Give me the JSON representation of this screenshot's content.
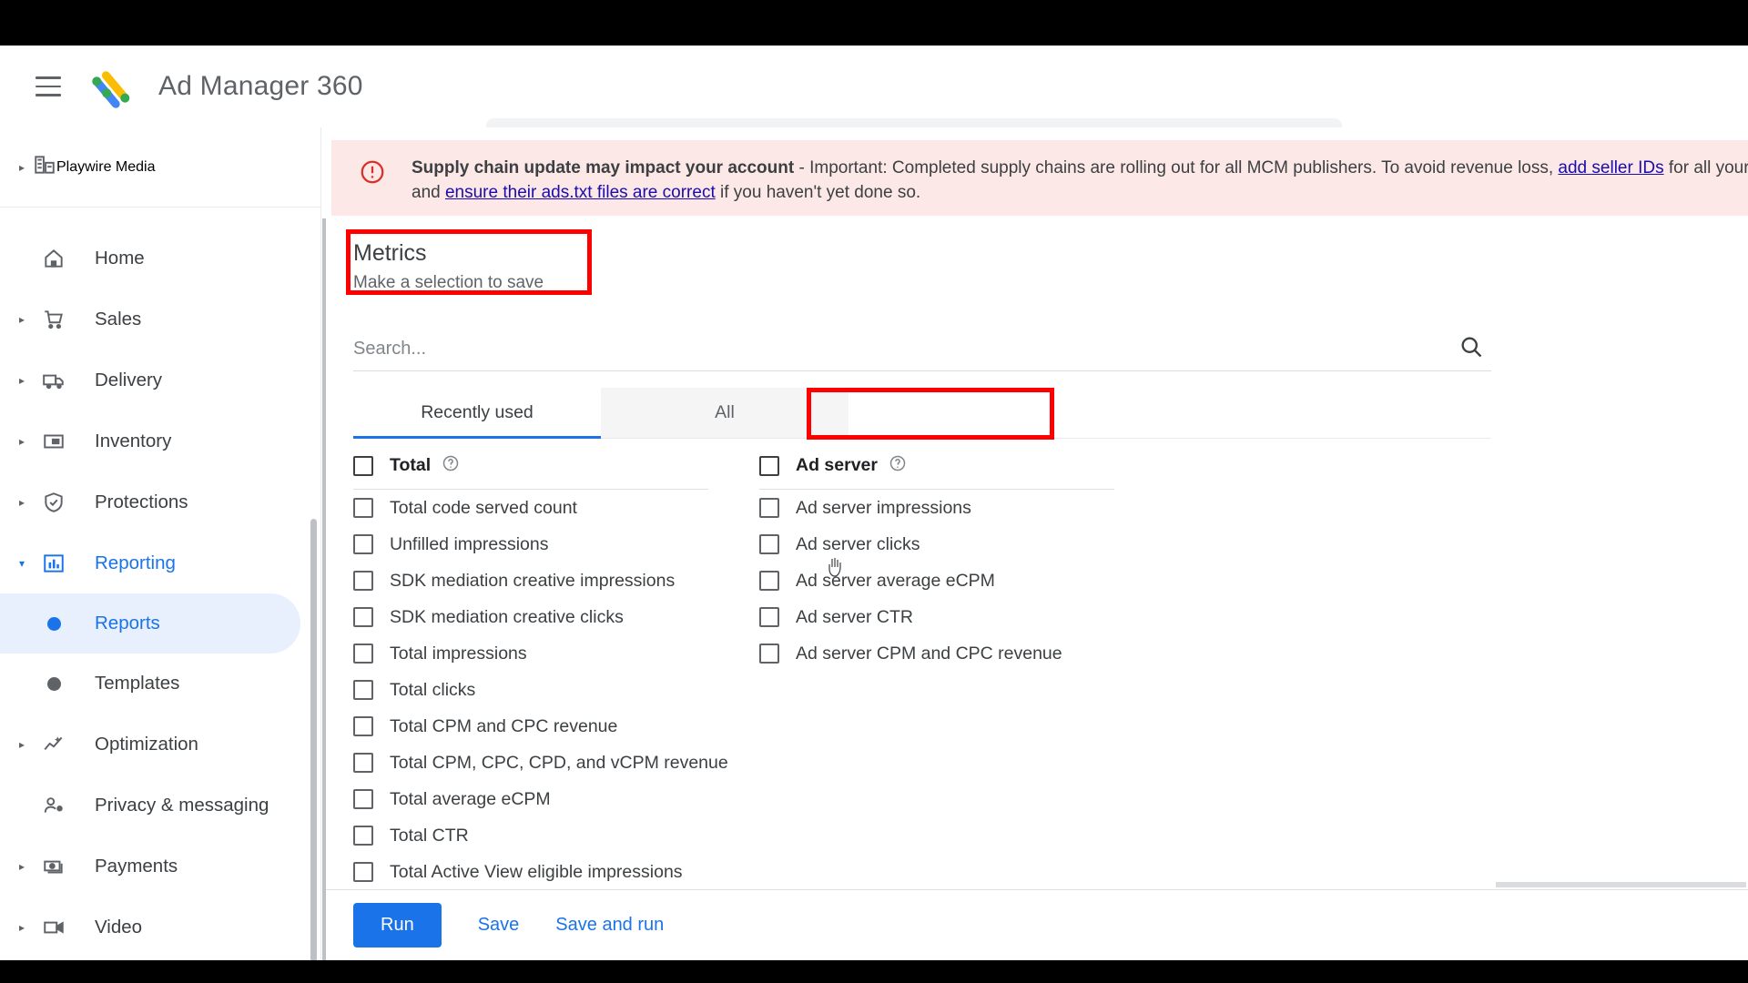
{
  "topbar": {
    "menu_icon": "hamburger-icon",
    "logo_icon": "ad-manager-logo",
    "title": "Ad Manager 360",
    "search_icon": "search-icon",
    "search_placeholder": ""
  },
  "sidebar": {
    "account": {
      "icon": "network-icon",
      "label": "Playwire Media"
    },
    "items": [
      {
        "label": "Home",
        "icon": "home-icon",
        "expandable": false,
        "active": false
      },
      {
        "label": "Sales",
        "icon": "cart-icon",
        "expandable": true,
        "active": false
      },
      {
        "label": "Delivery",
        "icon": "truck-icon",
        "expandable": true,
        "active": false
      },
      {
        "label": "Inventory",
        "icon": "inventory-icon",
        "expandable": true,
        "active": false
      },
      {
        "label": "Protections",
        "icon": "shield-check-icon",
        "expandable": true,
        "active": false
      },
      {
        "label": "Reporting",
        "icon": "bar-chart-icon",
        "expandable": true,
        "active": true
      },
      {
        "label": "Reports",
        "icon": "dot-icon",
        "sub": true,
        "selected": true
      },
      {
        "label": "Templates",
        "icon": "dot-icon",
        "sub": true,
        "selected": false
      },
      {
        "label": "Optimization",
        "icon": "optimization-icon",
        "expandable": true,
        "active": false
      },
      {
        "label": "Privacy & messaging",
        "icon": "person-shield-icon",
        "expandable": false,
        "active": false
      },
      {
        "label": "Payments",
        "icon": "money-icon",
        "expandable": true,
        "active": false
      },
      {
        "label": "Video",
        "icon": "video-icon",
        "expandable": true,
        "active": false
      }
    ]
  },
  "banner": {
    "icon": "error-circle-icon",
    "line1_bold": "Supply chain update may impact your account",
    "line1_rest": " - Important: Completed supply chains are rolling out for all MCM publishers. To avoid revenue loss, ",
    "line1_link": "add seller IDs",
    "line1_tail": " for all your child publishe",
    "line2_lead": "and ",
    "line2_link": "ensure their ads.txt files are correct",
    "line2_tail": " if you haven't yet done so."
  },
  "panel": {
    "title": "Metrics",
    "subtitle": "Make a selection to save",
    "search_placeholder": "Search...",
    "search_value": "",
    "search_icon": "search-icon",
    "tabs": [
      {
        "label": "Recently used",
        "selected": true
      },
      {
        "label": "All",
        "selected": false,
        "hovered": true
      }
    ],
    "columns": [
      {
        "header": {
          "label": "Total",
          "help_icon": "help-icon",
          "checked": false
        },
        "options": [
          {
            "label": "Total code served count",
            "checked": false
          },
          {
            "label": "Unfilled impressions",
            "checked": false
          },
          {
            "label": "SDK mediation creative impressions",
            "checked": false
          },
          {
            "label": "SDK mediation creative clicks",
            "checked": false
          },
          {
            "label": "Total impressions",
            "checked": false
          },
          {
            "label": "Total clicks",
            "checked": false
          },
          {
            "label": "Total CPM and CPC revenue",
            "checked": false
          },
          {
            "label": "Total CPM, CPC, CPD, and vCPM revenue",
            "checked": false
          },
          {
            "label": "Total average eCPM",
            "checked": false
          },
          {
            "label": "Total CTR",
            "checked": false
          },
          {
            "label": "Total Active View eligible impressions",
            "checked": false
          }
        ]
      },
      {
        "header": {
          "label": "Ad server",
          "help_icon": "help-icon",
          "checked": false
        },
        "options": [
          {
            "label": "Ad server impressions",
            "checked": false
          },
          {
            "label": "Ad server clicks",
            "checked": false
          },
          {
            "label": "Ad server average eCPM",
            "checked": false
          },
          {
            "label": "Ad server CTR",
            "checked": false
          },
          {
            "label": "Ad server CPM and CPC revenue",
            "checked": false
          }
        ]
      }
    ]
  },
  "actions": {
    "run_label": "Run",
    "save_label": "Save",
    "save_and_run_label": "Save and run"
  },
  "colors": {
    "accent": "#1a73e8",
    "banner_bg": "#fce8e6",
    "banner_icon": "#d93025",
    "highlight_box": "#ff0000",
    "selected_nav_bg": "#e8f0fe",
    "link": "#1a0dab"
  }
}
